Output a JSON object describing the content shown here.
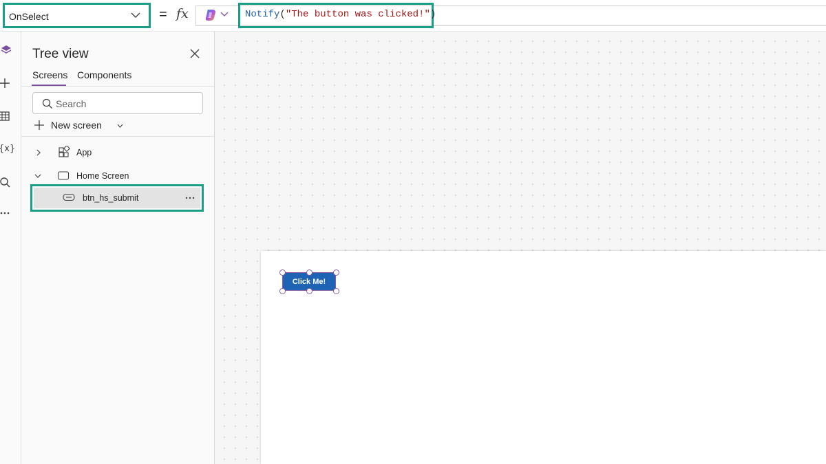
{
  "formula_bar": {
    "property": "OnSelect",
    "equals": "=",
    "fx": "fx",
    "formula": {
      "function": "Notify",
      "open": "(",
      "string": "\"The button was clicked!\"",
      "close": ")"
    }
  },
  "rail": {
    "items": [
      "layers-icon",
      "plus-icon",
      "table-icon",
      "variables-icon",
      "search-icon",
      "more-icon"
    ],
    "variables_glyph": "(x)",
    "more_glyph": "···"
  },
  "tree_view": {
    "title": "Tree view",
    "tabs": [
      {
        "label": "Screens",
        "active": true
      },
      {
        "label": "Components",
        "active": false
      }
    ],
    "search_placeholder": "Search",
    "new_screen_label": "New screen",
    "nodes": {
      "app": {
        "label": "App",
        "expanded": false
      },
      "home_screen": {
        "label": "Home Screen",
        "expanded": true
      },
      "button": {
        "label": "btn_hs_submit",
        "selected": true,
        "more": "···"
      }
    }
  },
  "canvas": {
    "button_text": "Click Me!"
  },
  "colors": {
    "highlight_frame": "#1a9e87",
    "selection": "#8a5aa8",
    "button_fill": "#1f63b4",
    "tab_active": "#7b4fa0",
    "formula_function": "#1f5fa6",
    "formula_string": "#a31515"
  }
}
